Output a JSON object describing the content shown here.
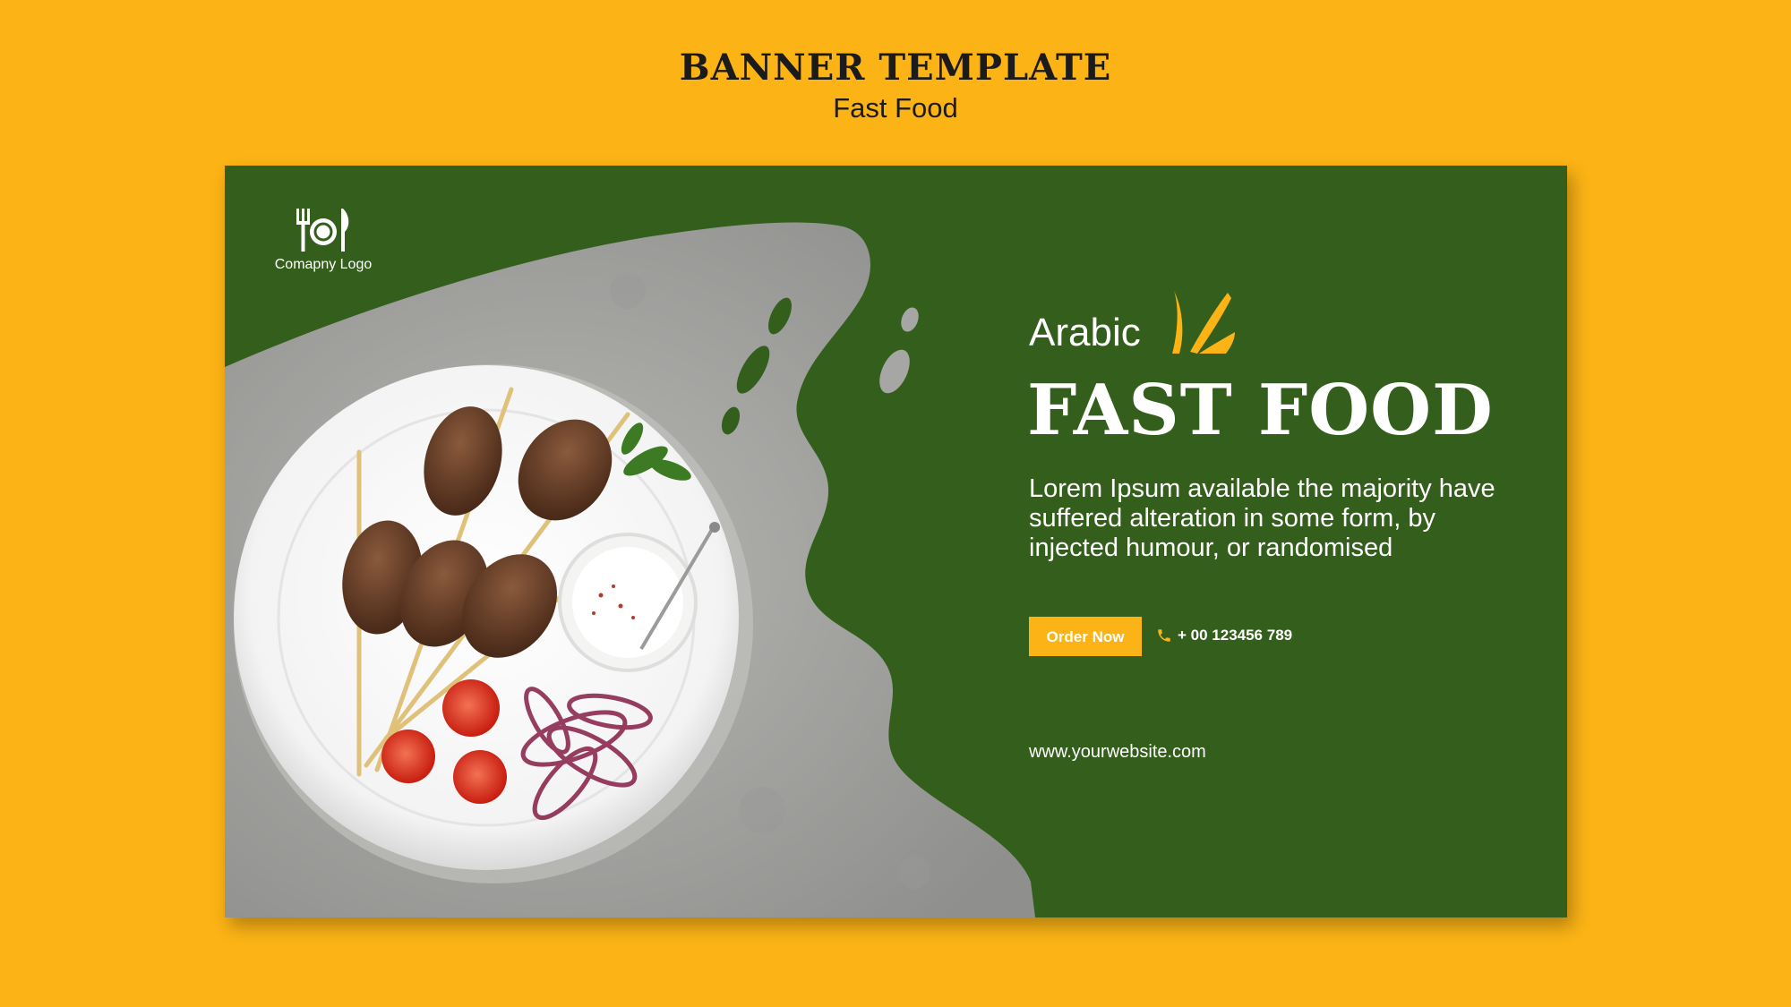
{
  "header": {
    "title": "BANNER TEMPLATE",
    "subtitle": "Fast Food"
  },
  "banner": {
    "logo_label": "Comapny Logo",
    "logo_icon": "cutlery-plate-icon",
    "eyebrow": "Arabic",
    "burst_icon": "burst-icon",
    "headline": "FAST FOOD",
    "description": "Lorem Ipsum available the majority have suffered alteration in some form, by injected humour, or randomised",
    "cta_label": "Order Now",
    "phone_icon": "phone-icon",
    "phone": "+ 00 123456 789",
    "website": "www.yourwebsite.com",
    "photo": "kebab-plate-photo"
  },
  "colors": {
    "background": "#FBB315",
    "banner_green": "#345E1B",
    "accent": "#FBB315",
    "stone_gray": "#A9A9A7",
    "text_dark": "#1B1B1B"
  }
}
